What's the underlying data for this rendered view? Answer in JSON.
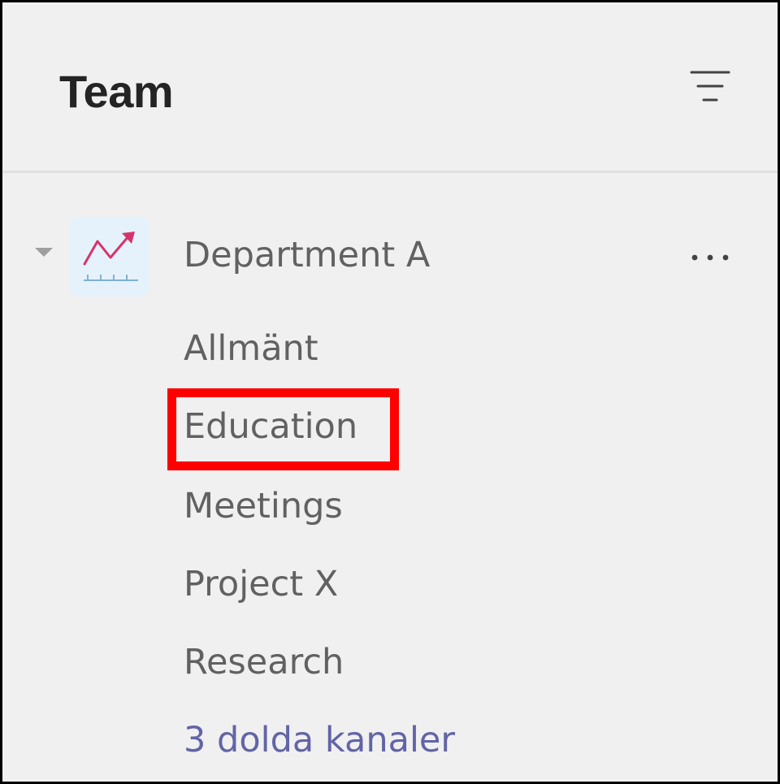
{
  "header": {
    "title": "Team",
    "filter_icon": "filter-icon"
  },
  "team": {
    "name": "Department A",
    "avatar_icon": "trend-chart-icon",
    "expand_icon": "caret-down-icon",
    "more_icon": "more-options-icon",
    "channels": [
      {
        "label": "Allmänt"
      },
      {
        "label": "Education",
        "highlighted": true
      },
      {
        "label": "Meetings"
      },
      {
        "label": "Project X"
      },
      {
        "label": "Research"
      }
    ],
    "hidden_channels_label": "3 dolda kanaler"
  },
  "colors": {
    "panel_background": "#f0f0f0",
    "title_text": "#242424",
    "secondary_text": "#616161",
    "link_text": "#6264a7",
    "avatar_background": "#e6f2fb",
    "avatar_accent": "#d6336c",
    "highlight_border": "#ff0000"
  }
}
